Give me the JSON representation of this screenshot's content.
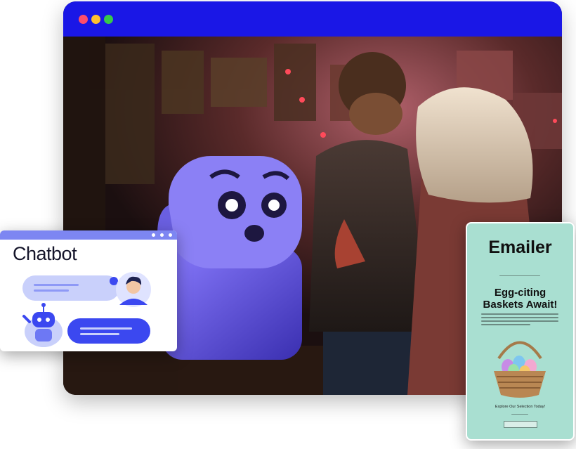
{
  "browser": {
    "window_controls": [
      "close-dot",
      "minimize-dot",
      "maximize-dot"
    ],
    "colors": {
      "bar": "#1a17e6",
      "close": "#ff4d6b",
      "minimize": "#ffbf2e",
      "maximize": "#37c94a"
    }
  },
  "chatbot": {
    "title": "Chatbot",
    "colors": {
      "bar": "#7d86f2",
      "bubble": "#c9d0fb",
      "bubble_dark": "#3b48f0"
    }
  },
  "emailer": {
    "title": "Emailer",
    "headline_line1": "Egg-citing",
    "headline_line2": "Baskets Await!",
    "cta_text": "Explore Our Selection Today!",
    "colors": {
      "background": "#a9dfd1"
    }
  }
}
